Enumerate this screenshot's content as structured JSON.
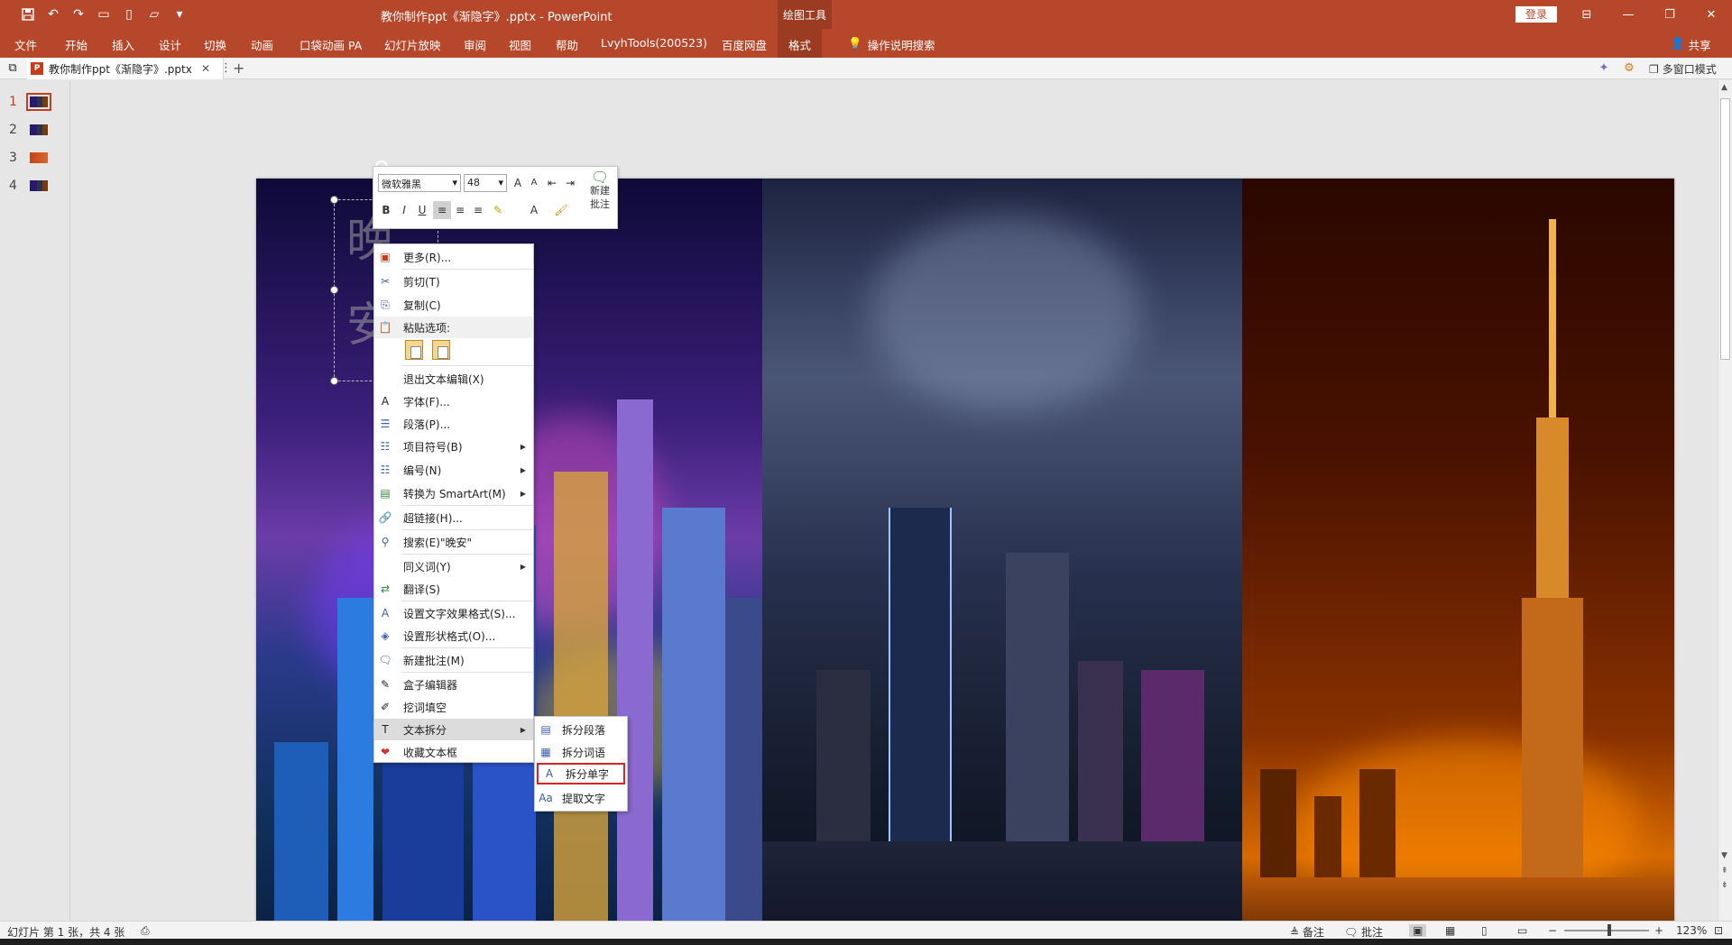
{
  "window": {
    "title": "教你制作ppt《渐隐字》.pptx  -  PowerPoint",
    "context_group": "绘图工具",
    "login_label": "登录",
    "min_label": "—",
    "max_label": "❐",
    "close_label": "✕",
    "ribbon_display_label": "⊟"
  },
  "quick_access": [
    "save-icon",
    "undo-icon",
    "redo-icon",
    "slideshow-icon",
    "new-icon",
    "open-icon",
    "customize-icon"
  ],
  "ribbon": {
    "tabs": [
      "文件",
      "开始",
      "插入",
      "设计",
      "切换",
      "动画",
      "口袋动画 PA",
      "幻灯片放映",
      "审阅",
      "视图",
      "帮助",
      "LvyhTools(200523)",
      "百度网盘"
    ],
    "context_tab": "格式",
    "tell_me": "操作说明搜索",
    "share": "共享"
  },
  "doc_tabs": {
    "active": "教你制作ppt《渐隐字》.pptx",
    "close": "✕",
    "more": "⋮",
    "add": "+",
    "multi_window": "多窗口模式"
  },
  "thumbnails": [
    {
      "num": "1",
      "active": true
    },
    {
      "num": "2",
      "active": false
    },
    {
      "num": "3",
      "active": false
    },
    {
      "num": "4",
      "active": false
    }
  ],
  "slide": {
    "ghost_chars": [
      "晚",
      "安"
    ]
  },
  "mini_toolbar": {
    "font": "微软雅黑",
    "size": "48",
    "grow": "A",
    "shrink": "A",
    "bold": "B",
    "italic": "I",
    "underline": "U",
    "new_comment_line1": "新建",
    "new_comment_line2": "批注"
  },
  "context_menu": {
    "items": [
      {
        "label": "更多(R)...",
        "icon": "more-icon"
      },
      {
        "label": "剪切(T)",
        "icon": "scissors-icon"
      },
      {
        "label": "复制(C)",
        "icon": "copy-icon"
      },
      {
        "label": "粘贴选项:",
        "icon": "paste-icon"
      },
      {
        "label": "退出文本编辑(X)",
        "icon": ""
      },
      {
        "label": "字体(F)...",
        "icon": "font-icon"
      },
      {
        "label": "段落(P)...",
        "icon": "paragraph-icon"
      },
      {
        "label": "项目符号(B)",
        "icon": "bullets-icon",
        "submenu": true
      },
      {
        "label": "编号(N)",
        "icon": "numbering-icon",
        "submenu": true
      },
      {
        "label": "转换为 SmartArt(M)",
        "icon": "smartart-icon",
        "submenu": true
      },
      {
        "label": "超链接(H)...",
        "icon": "link-icon"
      },
      {
        "label": "搜索(E)\"晚安\"",
        "icon": "search-icon"
      },
      {
        "label": "同义词(Y)",
        "icon": "",
        "submenu": true
      },
      {
        "label": "翻译(S)",
        "icon": "translate-icon"
      },
      {
        "label": "设置文字效果格式(S)...",
        "icon": "text-effect-icon"
      },
      {
        "label": "设置形状格式(O)...",
        "icon": "shape-format-icon"
      },
      {
        "label": "新建批注(M)",
        "icon": "comment-icon"
      },
      {
        "label": "盒子编辑器",
        "icon": "box-editor-icon"
      },
      {
        "label": "挖词填空",
        "icon": "fill-blank-icon"
      },
      {
        "label": "文本拆分",
        "icon": "text-split-icon",
        "submenu": true,
        "highlighted": true
      },
      {
        "label": "收藏文本框",
        "icon": "favorite-icon"
      }
    ]
  },
  "submenu": {
    "items": [
      {
        "label": "拆分段落",
        "icon": "split-paragraph-icon"
      },
      {
        "label": "拆分词语",
        "icon": "split-words-icon"
      },
      {
        "label": "拆分单字",
        "icon": "split-chars-icon",
        "boxed": true
      },
      {
        "label": "提取文字",
        "icon": "extract-text-icon"
      }
    ]
  },
  "statusbar": {
    "slide_info": "幻灯片 第 1 张，共 4 张",
    "notes": "备注",
    "comments": "批注",
    "zoom": "123%",
    "zoom_minus": "−",
    "zoom_plus": "+"
  },
  "colors": {
    "accent": "#b7472a",
    "highlight_box": "#e02020"
  },
  "scrollbar": {
    "up": "▲",
    "down": "▼",
    "prev": "⇞",
    "next": "⇟"
  }
}
